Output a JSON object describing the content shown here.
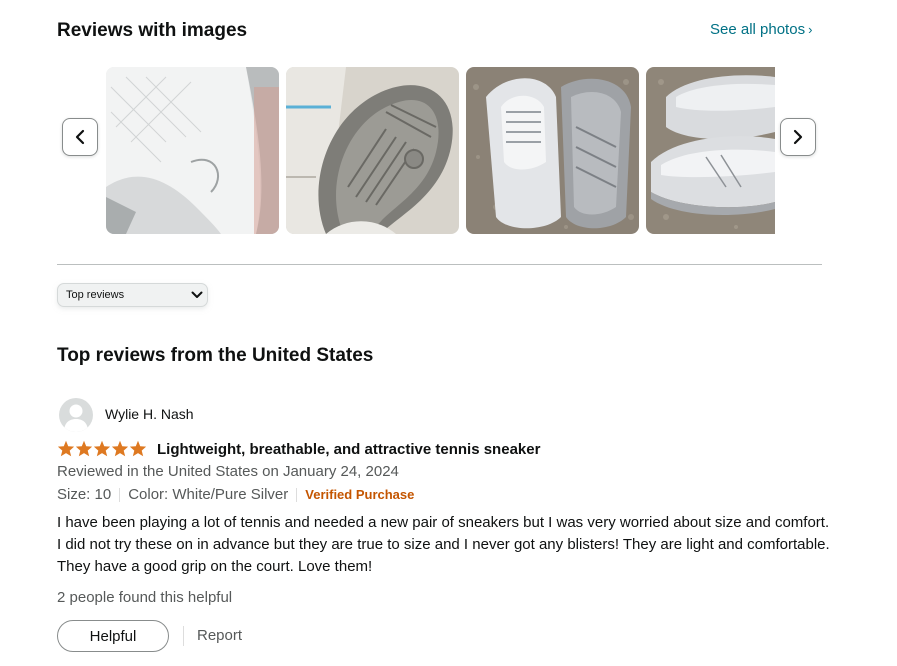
{
  "images_section": {
    "title": "Reviews with images",
    "see_all_label": "See all photos",
    "see_all_chevron": "›",
    "prev_icon": "chevron-left-icon",
    "next_icon": "chevron-right-icon",
    "thumbnail_icons": [
      "shoe-toe-photo",
      "shoe-sole-photo",
      "shoe-pair-photo",
      "shoe-pair-side-photo"
    ]
  },
  "sort": {
    "selected": "Top reviews"
  },
  "reviews_section": {
    "heading": "Top reviews from the United States"
  },
  "review": {
    "reviewer_name": "Wylie H. Nash",
    "rating": 5,
    "rating_max": 5,
    "title": "Lightweight, breathable, and attractive tennis sneaker",
    "date_line": "Reviewed in the United States on January 24, 2024",
    "size": "Size: 10",
    "color": "Color: White/Pure Silver",
    "verified": "Verified Purchase",
    "body": "I have been playing a lot of tennis and needed a new pair of sneakers but I was very worried about size and comfort. I did not try these on in advance but they are true to size and I never got any blisters! They are light and comfortable. They have a good grip on the court. Love them!",
    "helpful_count": "2 people found this helpful",
    "helpful_button": "Helpful",
    "report_label": "Report"
  },
  "colors": {
    "link": "#007185",
    "star": "#de7921",
    "verified": "#c45500",
    "secondary_text": "#565959"
  }
}
